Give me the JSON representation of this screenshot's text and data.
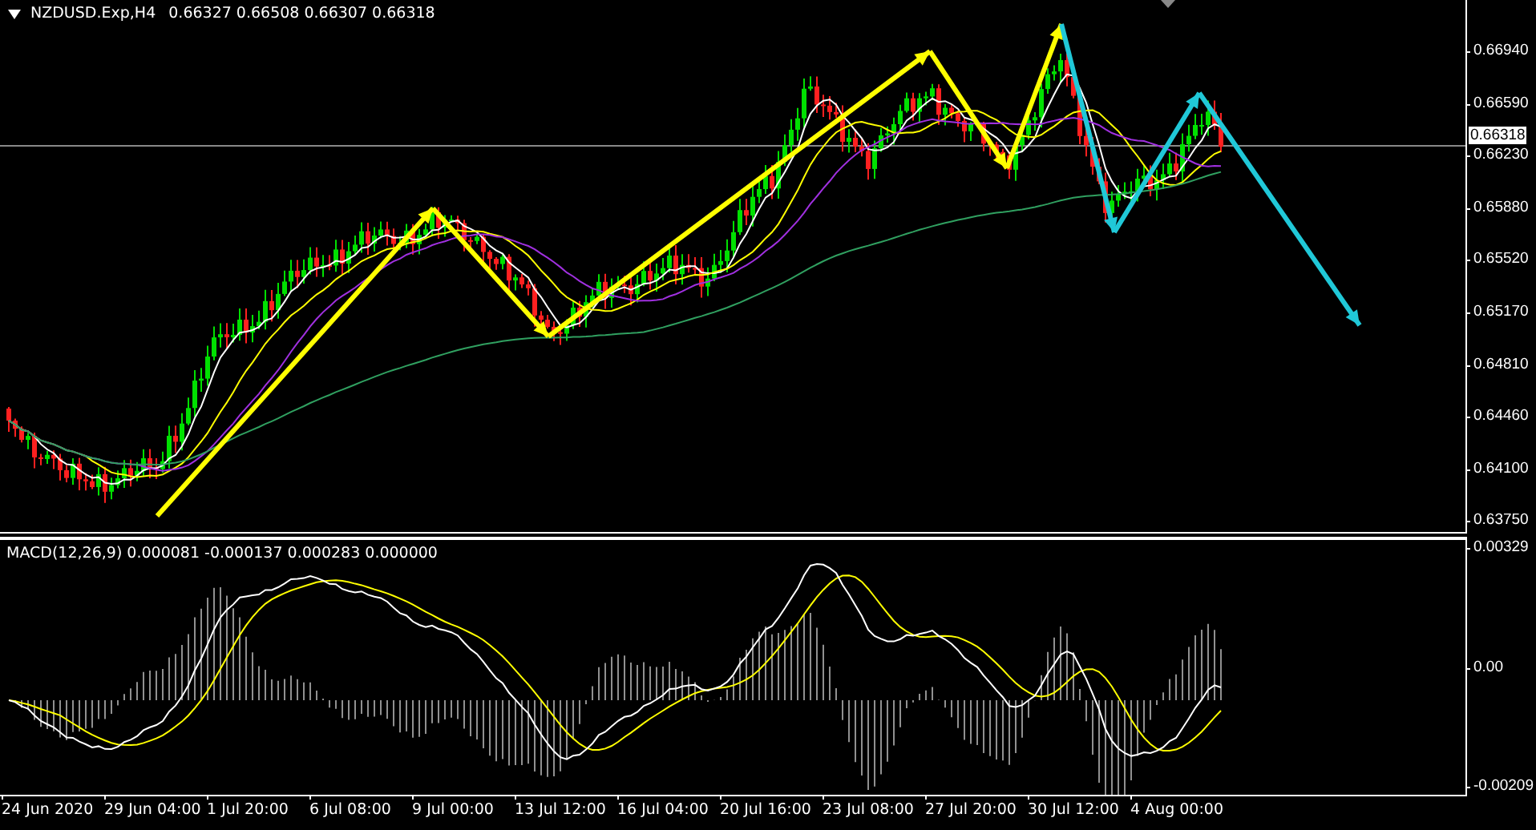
{
  "chart": {
    "title": "NZDUSD.Exp,H4",
    "quote": "0.66327 0.66508 0.66307 0.66318"
  },
  "price_axis": {
    "ticks": [
      "0.66940",
      "0.66590",
      "0.66230",
      "0.65880",
      "0.65520",
      "0.65170",
      "0.64810",
      "0.64460",
      "0.64100",
      "0.63750"
    ],
    "current_price": "0.66318"
  },
  "indicator": {
    "label": "MACD(12,26,9) 0.000081 -0.000137 0.000283 0.000000",
    "axis_ticks": [
      "0.00329",
      "0.00",
      "-0.00209"
    ]
  },
  "time_axis": {
    "labels": [
      "24 Jun 2020",
      "29 Jun 04:00",
      "1 Jul 20:00",
      "6 Jul 08:00",
      "9 Jul 00:00",
      "13 Jul 12:00",
      "16 Jul 04:00",
      "20 Jul 16:00",
      "23 Jul 08:00",
      "27 Jul 20:00",
      "30 Jul 12:00",
      "4 Aug 00:00"
    ]
  }
}
